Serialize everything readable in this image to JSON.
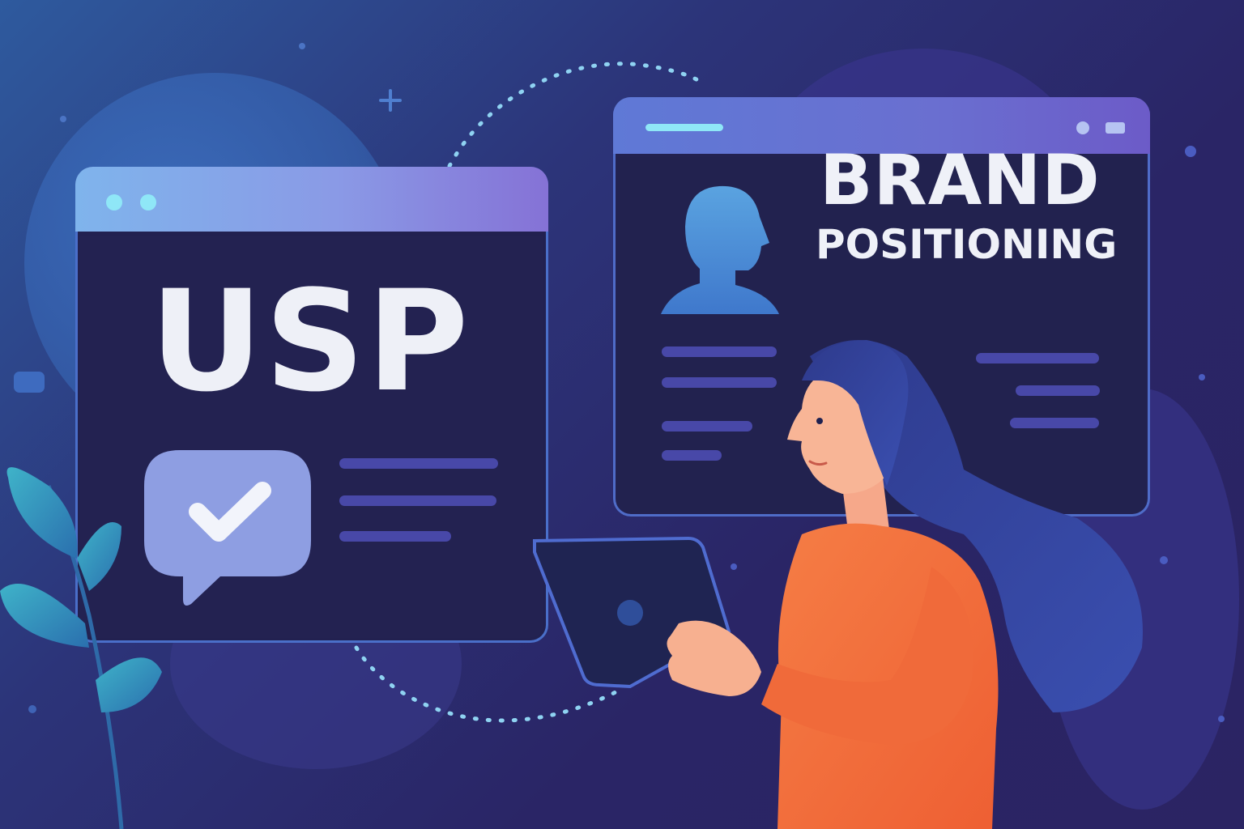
{
  "usp_card": {
    "title": "USP",
    "badge_icon": "checkmark-speech-bubble-icon"
  },
  "brand_card": {
    "title": "BRAND",
    "subtitle": "POSITIONING",
    "avatar_icon": "person-silhouette-icon"
  },
  "illustration": {
    "person": "woman-holding-tablet",
    "plant": "leaf-plant"
  },
  "colors": {
    "background_start": "#2e5a9e",
    "background_end": "#2a2566",
    "window_body": "#232251",
    "accent_orange": "#f2733f",
    "accent_cyan": "#8fe7f7"
  }
}
